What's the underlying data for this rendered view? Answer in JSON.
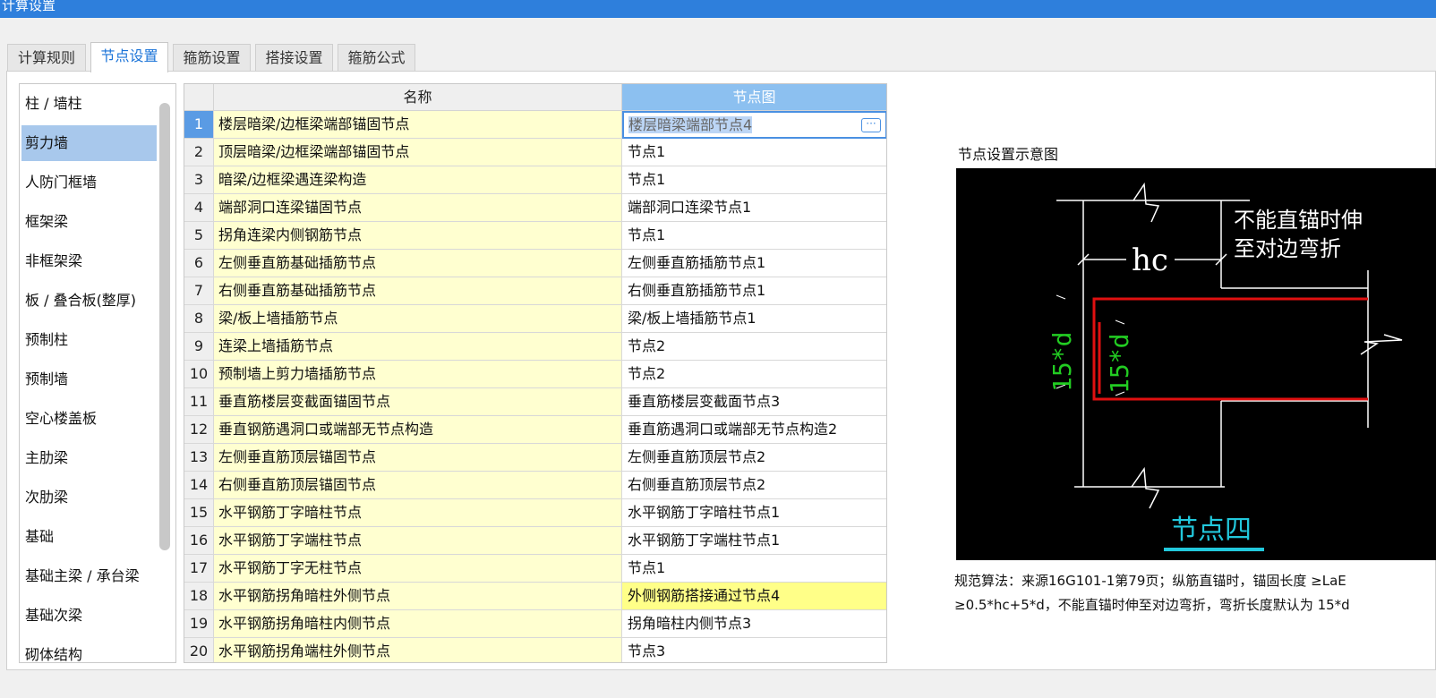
{
  "window": {
    "title": "计算设置"
  },
  "tabs": [
    {
      "label": "计算规则"
    },
    {
      "label": "节点设置"
    },
    {
      "label": "箍筋设置"
    },
    {
      "label": "搭接设置"
    },
    {
      "label": "箍筋公式"
    }
  ],
  "categories": [
    {
      "label": "柱 / 墙柱"
    },
    {
      "label": "剪力墙"
    },
    {
      "label": "人防门框墙"
    },
    {
      "label": "框架梁"
    },
    {
      "label": "非框架梁"
    },
    {
      "label": "板 / 叠合板(整厚)"
    },
    {
      "label": "预制柱"
    },
    {
      "label": "预制墙"
    },
    {
      "label": "空心楼盖板"
    },
    {
      "label": "主肋梁"
    },
    {
      "label": "次肋梁"
    },
    {
      "label": "基础"
    },
    {
      "label": "基础主梁 / 承台梁"
    },
    {
      "label": "基础次梁"
    },
    {
      "label": "砌体结构"
    }
  ],
  "grid": {
    "headers": {
      "name": "名称",
      "node": "节点图"
    },
    "rows": [
      {
        "num": "1",
        "name": "楼层暗梁/边框梁端部锚固节点",
        "node": "楼层暗梁端部节点4"
      },
      {
        "num": "2",
        "name": "顶层暗梁/边框梁端部锚固节点",
        "node": "节点1"
      },
      {
        "num": "3",
        "name": "暗梁/边框梁遇连梁构造",
        "node": "节点1"
      },
      {
        "num": "4",
        "name": "端部洞口连梁锚固节点",
        "node": "端部洞口连梁节点1"
      },
      {
        "num": "5",
        "name": "拐角连梁内侧钢筋节点",
        "node": "节点1"
      },
      {
        "num": "6",
        "name": "左侧垂直筋基础插筋节点",
        "node": "左侧垂直筋插筋节点1"
      },
      {
        "num": "7",
        "name": "右侧垂直筋基础插筋节点",
        "node": "右侧垂直筋插筋节点1"
      },
      {
        "num": "8",
        "name": "梁/板上墙插筋节点",
        "node": "梁/板上墙插筋节点1"
      },
      {
        "num": "9",
        "name": "连梁上墙插筋节点",
        "node": "节点2"
      },
      {
        "num": "10",
        "name": "预制墙上剪力墙插筋节点",
        "node": "节点2"
      },
      {
        "num": "11",
        "name": "垂直筋楼层变截面锚固节点",
        "node": "垂直筋楼层变截面节点3"
      },
      {
        "num": "12",
        "name": "垂直钢筋遇洞口或端部无节点构造",
        "node": "垂直筋遇洞口或端部无节点构造2"
      },
      {
        "num": "13",
        "name": "左侧垂直筋顶层锚固节点",
        "node": "左侧垂直筋顶层节点2"
      },
      {
        "num": "14",
        "name": "右侧垂直筋顶层锚固节点",
        "node": "右侧垂直筋顶层节点2"
      },
      {
        "num": "15",
        "name": "水平钢筋丁字暗柱节点",
        "node": "水平钢筋丁字暗柱节点1"
      },
      {
        "num": "16",
        "name": "水平钢筋丁字端柱节点",
        "node": "水平钢筋丁字端柱节点1"
      },
      {
        "num": "17",
        "name": "水平钢筋丁字无柱节点",
        "node": "节点1"
      },
      {
        "num": "18",
        "name": "水平钢筋拐角暗柱外侧节点",
        "node": "外侧钢筋搭接通过节点4"
      },
      {
        "num": "19",
        "name": "水平钢筋拐角暗柱内侧节点",
        "node": "拐角暗柱内侧节点3"
      },
      {
        "num": "20",
        "name": "水平钢筋拐角端柱外侧节点",
        "node": "节点3"
      }
    ],
    "ellipsis_label": "···"
  },
  "preview": {
    "title": "节点设置示意图",
    "note_line1": "不能直锚时伸",
    "note_line2": "至对边弯折",
    "dim_hc": "hc",
    "dim_15d": "15*d",
    "caption": "节点四",
    "colors": {
      "bg": "#000000",
      "lines": "#ffffff",
      "rebar": "#e01010",
      "dim": "#22cc22",
      "caption": "#22c8dc"
    }
  },
  "description": {
    "line1": "规范算法：来源16G101-1第79页；纵筋直锚时，锚固长度 ≥LaE",
    "line2": "≥0.5*hc+5*d，不能直锚时伸至对边弯折，弯折长度默认为 15*d"
  },
  "colors": {
    "titlebar": "#2e7fdc",
    "accent": "#1a73d8",
    "name_cell": "#ffffd0",
    "highlight_cell": "#ffff88",
    "selected_category": "#a8c8ec"
  }
}
